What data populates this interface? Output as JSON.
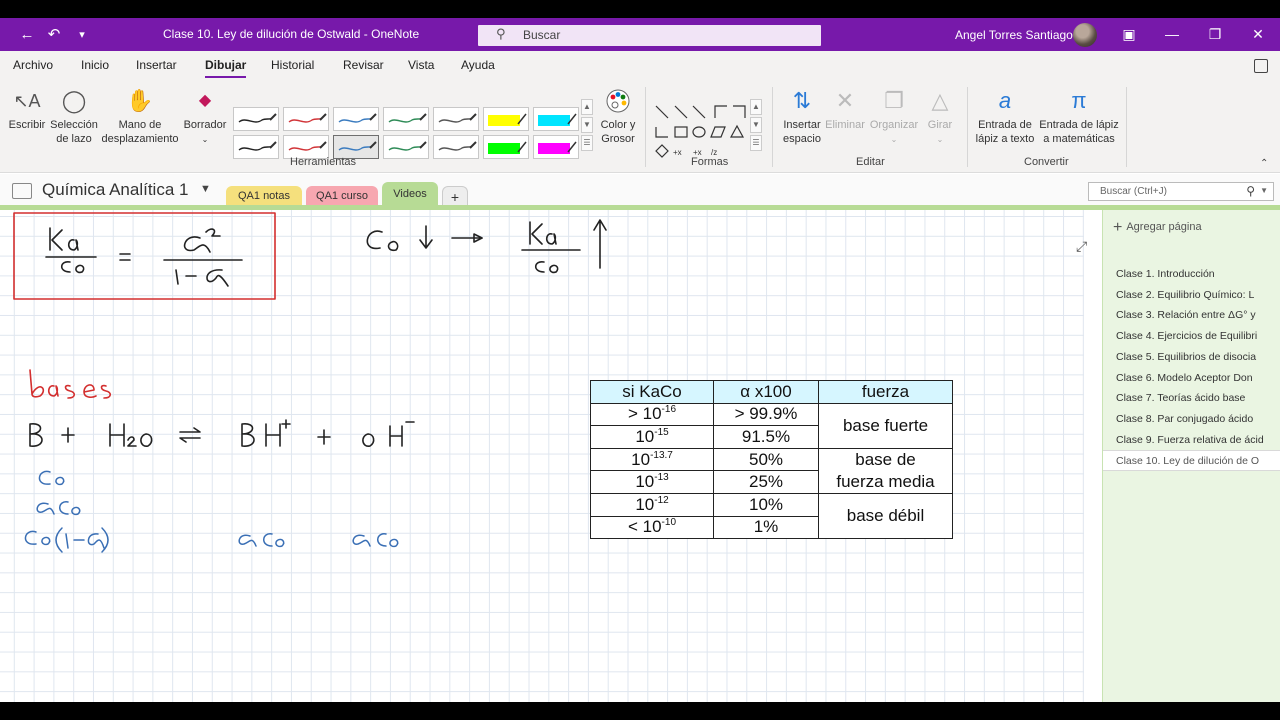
{
  "titlebar": {
    "doc_title": "Clase 10. Ley de dilución de Ostwald  -  OneNote",
    "search_placeholder": "Buscar",
    "user_name": "Angel Torres Santiago"
  },
  "ribbon_tabs": [
    "Archivo",
    "Inicio",
    "Insertar",
    "Dibujar",
    "Historial",
    "Revisar",
    "Vista",
    "Ayuda"
  ],
  "active_tab": "Dibujar",
  "ribbon": {
    "escribir": "Escribir",
    "lasso_1": "Selección",
    "lasso_2": "de lazo",
    "hand_1": "Mano de",
    "hand_2": "desplazamiento",
    "eraser": "Borrador",
    "color_1": "Color y",
    "color_2": "Grosor",
    "insert_space_1": "Insertar",
    "insert_space_2": "espacio",
    "eliminar": "Eliminar",
    "organizar": "Organizar",
    "girar": "Girar",
    "ink_text_1": "Entrada de",
    "ink_text_2": "lápiz a texto",
    "ink_math_1": "Entrada de lápiz",
    "ink_math_2": "a matemáticas",
    "groups": {
      "herramientas": "Herramientas",
      "formas": "Formas",
      "editar": "Editar",
      "convertir": "Convertir"
    },
    "pen_colors_top": [
      "#222222",
      "#d13438",
      "#3a7bbf",
      "#2e8b57",
      "#555555"
    ],
    "pen_colors_bottom": [
      "#222222",
      "#d13438",
      "#3a7bbf",
      "#2e8b57",
      "#555555"
    ],
    "highlighters_top": [
      "#ffff00",
      "#00e5ff"
    ],
    "highlighters_bottom": [
      "#00ff00",
      "#ff00ff"
    ]
  },
  "notebook": {
    "name": "Química Analítica 1",
    "sections": [
      {
        "label": "QA1 notas",
        "color": "#f5e07d"
      },
      {
        "label": "QA1 curso",
        "color": "#f7a7b0"
      },
      {
        "label": "Videos",
        "color": "#b7db95"
      }
    ],
    "add_section": "+",
    "find_placeholder": "Buscar (Ctrl+J)"
  },
  "table": {
    "headers": [
      "si KaCo",
      "α x100",
      "fuerza"
    ],
    "rows": [
      {
        "ka_prefix": "> 10",
        "ka_exp": "-16",
        "alpha": "> 99.9%"
      },
      {
        "ka_prefix": "10",
        "ka_exp": "-15",
        "alpha": "91.5%"
      },
      {
        "ka_prefix": "10",
        "ka_exp": "-13.7",
        "alpha": "50%"
      },
      {
        "ka_prefix": "10",
        "ka_exp": "-13",
        "alpha": "25%"
      },
      {
        "ka_prefix": "10",
        "ka_exp": "-12",
        "alpha": "10%"
      },
      {
        "ka_prefix": "< 10",
        "ka_exp": "-10",
        "alpha": "1%"
      }
    ],
    "strength_1": "base fuerte",
    "strength_2a": "base de",
    "strength_2b": "fuerza media",
    "strength_3": "base débil"
  },
  "pages": {
    "add_label": "Agregar página",
    "items": [
      "Clase 1. Introducción",
      "Clase 2. Equilibrio Químico: L",
      "Clase 3. Relación entre ΔG° y",
      "Clase 4. Ejercicios de Equilibri",
      "Clase 5. Equilibrios de disocia",
      "Clase 6. Modelo Aceptor Don",
      "Clase 7. Teorías ácido base",
      "Clase 8. Par conjugado ácido",
      "Clase 9. Fuerza relativa de ácid",
      "Clase 10. Ley de dilución de O"
    ],
    "active_index": 9
  }
}
